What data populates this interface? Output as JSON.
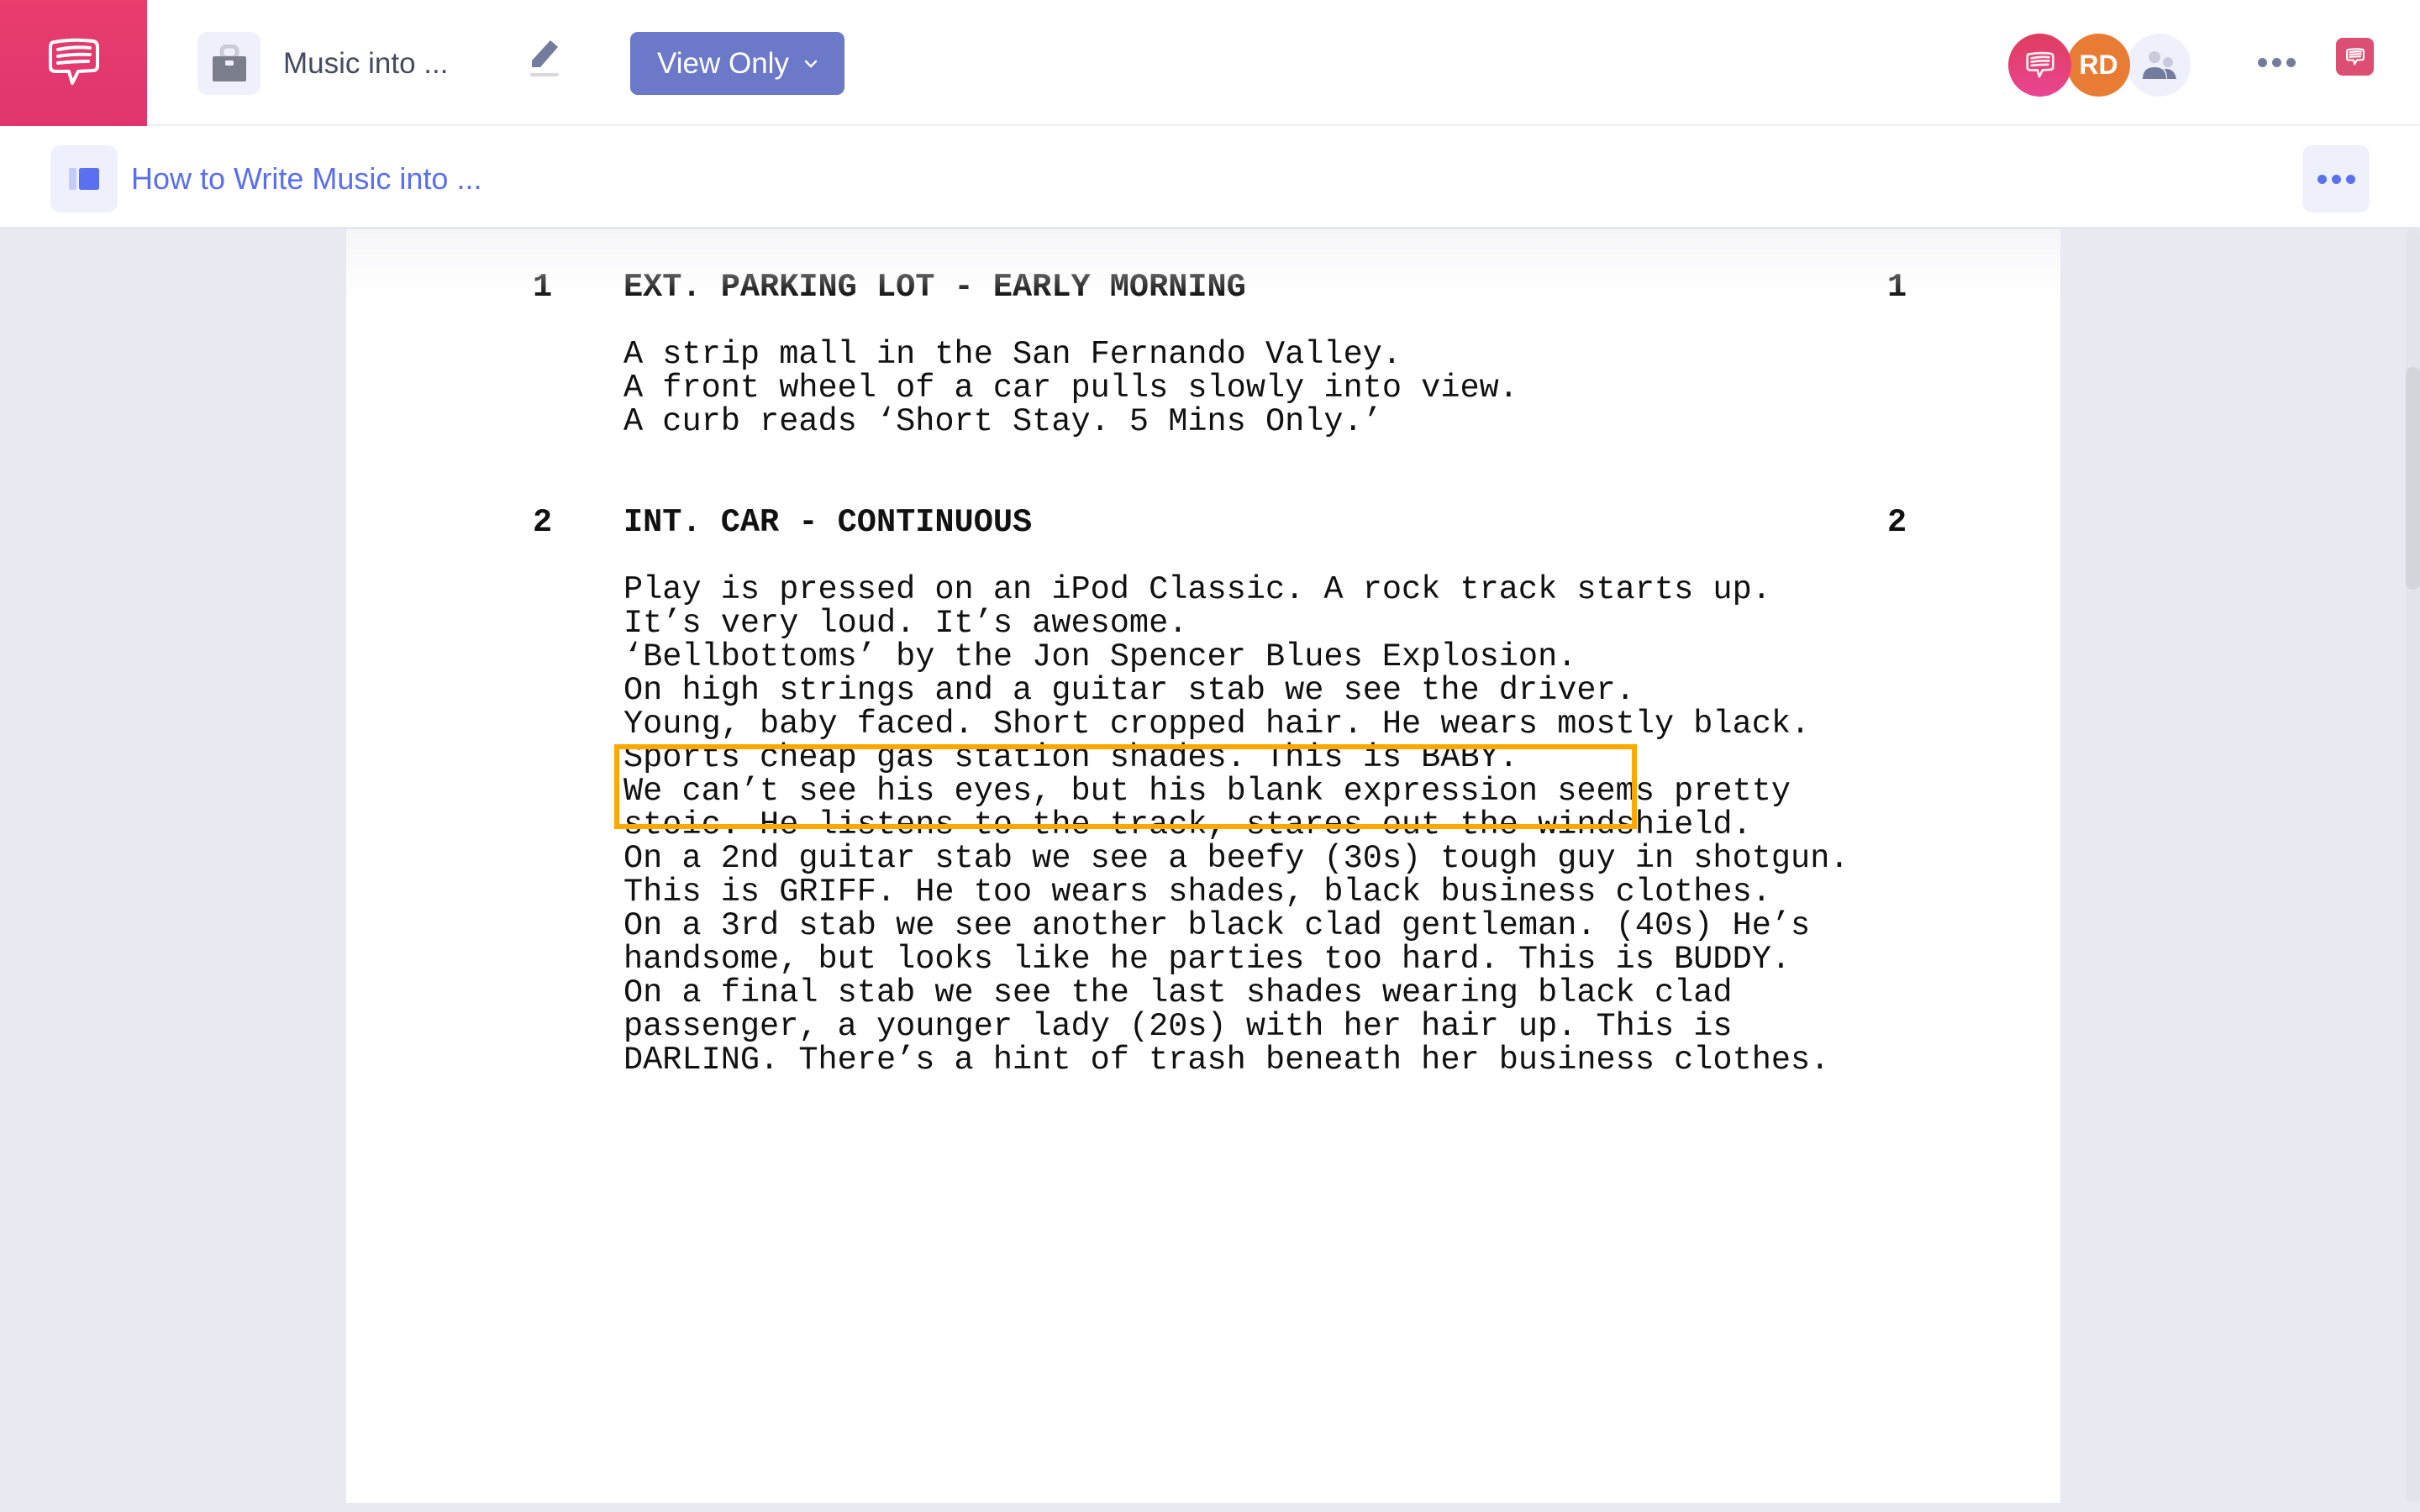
{
  "app": {
    "brand_color": "#E83D6D",
    "accent_color": "#5A6FEF",
    "logo_icon": "speech-bubble-icon"
  },
  "topbar": {
    "project_icon": "suitcase-icon",
    "project_title": "Music into ...",
    "edit_icon": "pencil-icon",
    "view_mode_button": {
      "label": "View Only",
      "icon": "chevron-down-icon",
      "color": "#6B79C8"
    },
    "collaborators": [
      {
        "type": "brand",
        "icon": "speech-bubble-icon"
      },
      {
        "type": "user",
        "initials": "RD",
        "color": "#E87C35"
      },
      {
        "type": "team",
        "icon": "people-icon"
      }
    ],
    "more_icon": "ellipsis-icon",
    "notifications_icon": "speech-bubble-icon"
  },
  "subbar": {
    "sidebar_toggle_icon": "sidebar-toggle-icon",
    "doc_title": "How to Write Music into ...",
    "more_icon": "ellipsis-icon"
  },
  "script": {
    "highlight_color": "#FFA800",
    "scenes": [
      {
        "number": "1",
        "heading": "EXT. PARKING LOT - EARLY MORNING",
        "action": [
          [
            "A strip mall in the San Fernando Valley."
          ],
          [
            "A front wheel of a car pulls slowly into view."
          ],
          [
            "A curb reads ‘Short Stay. 5 Mins Only.’"
          ]
        ]
      },
      {
        "number": "2",
        "heading": "INT. CAR - CONTINUOUS",
        "action": [
          [
            "Play is pressed on an iPod Classic. A rock track starts up."
          ],
          [
            "It’s very loud. It’s awesome."
          ],
          [
            "‘Bellbottoms’ by the Jon Spencer Blues Explosion."
          ],
          [
            "On high strings and a guitar stab we see the driver."
          ],
          [
            "Young, baby faced. Short cropped hair. He wears mostly black."
          ],
          [
            "Sports cheap gas station shades. This is BABY."
          ],
          [
            "We can’t see his eyes, but his blank expression seems pretty",
            "stoic. He listens to the track, stares out the windshield."
          ],
          [
            "On a 2nd guitar stab we see a beefy (30s) tough guy in shotgun."
          ],
          [
            "This is GRIFF. He too wears shades, black business clothes."
          ],
          [
            "On a 3rd stab we see another black clad gentleman. (40s) He’s",
            "handsome, but looks like he parties too hard. This is BUDDY."
          ],
          [
            "On a final stab we see the last shades wearing black clad",
            "passenger, a younger lady (20s) with her hair up. This is",
            "DARLING. There’s a hint of trash beneath her business clothes."
          ]
        ]
      }
    ],
    "highlighted": {
      "scene": 2,
      "paragraph": 3
    }
  }
}
